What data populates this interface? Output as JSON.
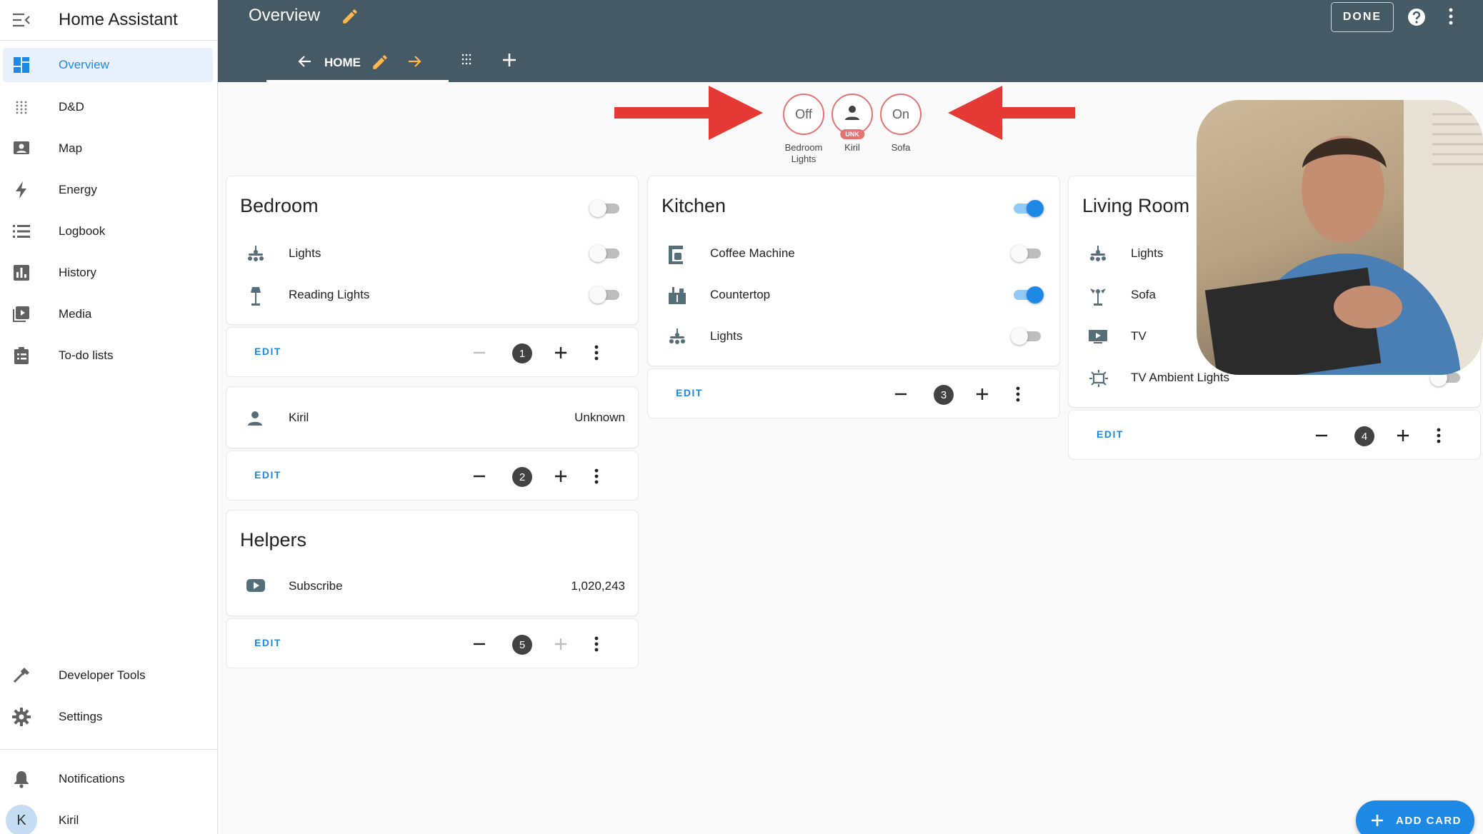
{
  "app": {
    "title": "Home Assistant"
  },
  "sidebar": {
    "items": [
      {
        "label": "Overview",
        "icon": "dashboard-icon"
      },
      {
        "label": "D&D",
        "icon": "grid-dots-icon"
      },
      {
        "label": "Map",
        "icon": "map-person-icon"
      },
      {
        "label": "Energy",
        "icon": "lightning-icon"
      },
      {
        "label": "Logbook",
        "icon": "list-icon"
      },
      {
        "label": "History",
        "icon": "bar-chart-icon"
      },
      {
        "label": "Media",
        "icon": "media-play-icon"
      },
      {
        "label": "To-do lists",
        "icon": "clipboard-list-icon"
      }
    ],
    "bottom_items": [
      {
        "label": "Developer Tools",
        "icon": "hammer-icon"
      },
      {
        "label": "Settings",
        "icon": "gear-icon"
      },
      {
        "label": "Notifications",
        "icon": "bell-icon"
      },
      {
        "label": "Kiril",
        "icon": "avatar"
      }
    ],
    "avatar_initial": "K",
    "active_color": "#1e88e5"
  },
  "header": {
    "title": "Overview",
    "done_label": "DONE",
    "view_tab_label": "HOME",
    "background": "#455a64"
  },
  "badges": [
    {
      "value": "Off",
      "label": "Bedroom Lights"
    },
    {
      "value": "",
      "label": "Kiril",
      "tag": "UNK"
    },
    {
      "value": "On",
      "label": "Sofa"
    }
  ],
  "cards": {
    "bedroom": {
      "title": "Bedroom",
      "master_on": false,
      "entities": [
        {
          "name": "Lights",
          "icon": "chandelier-icon",
          "on": false
        },
        {
          "name": "Reading Lights",
          "icon": "floor-lamp-icon",
          "on": false
        }
      ],
      "footer": {
        "edit": "EDIT",
        "position": "1"
      }
    },
    "kiril": {
      "entities": [
        {
          "name": "Kiril",
          "icon": "person-icon",
          "state": "Unknown"
        }
      ],
      "footer": {
        "edit": "EDIT",
        "position": "2"
      }
    },
    "helpers": {
      "title": "Helpers",
      "entities": [
        {
          "name": "Subscribe",
          "icon": "youtube-icon",
          "state": "1,020,243"
        }
      ],
      "footer": {
        "edit": "EDIT",
        "position": "5"
      }
    },
    "kitchen": {
      "title": "Kitchen",
      "master_on": true,
      "entities": [
        {
          "name": "Coffee Machine",
          "icon": "coffee-maker-icon",
          "on": false
        },
        {
          "name": "Countertop",
          "icon": "countertop-icon",
          "on": true
        },
        {
          "name": "Lights",
          "icon": "chandelier-icon",
          "on": false
        }
      ],
      "footer": {
        "edit": "EDIT",
        "position": "3"
      }
    },
    "living_room": {
      "title": "Living Room",
      "entities": [
        {
          "name": "Lights",
          "icon": "chandelier-icon"
        },
        {
          "name": "Sofa",
          "icon": "lamp-icon"
        },
        {
          "name": "TV",
          "icon": "tv-icon"
        },
        {
          "name": "TV Ambient Lights",
          "icon": "led-strip-icon",
          "on": false
        }
      ],
      "footer": {
        "edit": "EDIT",
        "position": "4"
      }
    }
  },
  "add_card_label": "ADD CARD",
  "colors": {
    "accent": "#1e88e5",
    "arrow": "#e53935",
    "badge_border": "#e57373"
  }
}
